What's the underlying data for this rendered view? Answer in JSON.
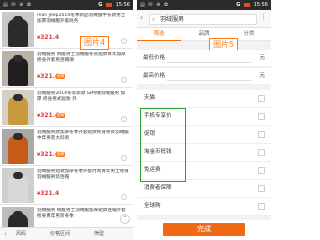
{
  "left": {
    "status": {
      "time": "15:56",
      "signal": "G",
      "icons": "▤ ✉ ⊕ ✿"
    },
    "items": [
      {
        "title": "man Jeep2014冬季新品羽绒服中长款男士加厚羽绒服外套商务",
        "price": "321.4",
        "tag": "",
        "sold": "",
        "bg": "#c9c9c9",
        "coat": "#2b2b2b"
      },
      {
        "title": "羽绒服男 韩版男士羽绒服冬装短款青年加厚修身外套男连帽潮",
        "price": "321.4",
        "tag": "包邮",
        "sold": "",
        "bg": "#b9b3a8",
        "coat": "#1e1e1e"
      },
      {
        "title": "羽绒服男2014冬装新款 白鸭绒羽绒服男 加厚 修身男式短款 外",
        "price": "321.4",
        "tag": "包邮",
        "sold": "",
        "bg": "#d6d0c4",
        "coat": "#c99a3d"
      },
      {
        "title": "羽绒服男款加厚冬季外套短款修身男式羽绒服中年男装大码男",
        "price": "321.4",
        "tag": "包邮",
        "sold": "",
        "bg": "#a9a9a9",
        "coat": "#c65a17"
      },
      {
        "title": "羽绒服男短款加厚冬季外套时尚青年男士修身羽绒服男装连帽",
        "price": "321.4",
        "tag": "",
        "sold": "",
        "bg": "#cfcfcf",
        "coat": "#d8d8d8"
      },
      {
        "title": "羽绒服男 韩版男士羽绒服加厚短款连帽外套修身青年男装冬季",
        "price": "321.4",
        "tag": "包邮",
        "sold": "",
        "bg": "#bdbdbd",
        "coat": "#2a2a2a"
      }
    ],
    "label": "图片4",
    "bottom": {
      "back": "‹",
      "b1": "风码",
      "b2": "价格区间",
      "b3": "筛型"
    },
    "fab": "⌃"
  },
  "right": {
    "search": {
      "value": "羽绒服男",
      "back": "‹",
      "menu": "⋮"
    },
    "tabs": [
      {
        "label": "筛选",
        "active": true
      },
      {
        "label": "品牌",
        "active": false
      },
      {
        "label": "分类",
        "active": false
      }
    ],
    "label": "图片5",
    "price_min": {
      "label": "最低价格",
      "unit": "元"
    },
    "price_max": {
      "label": "最高价格",
      "unit": "元"
    },
    "options": [
      {
        "label": "天猫"
      },
      {
        "label": "手机专享价"
      },
      {
        "label": "促销"
      },
      {
        "label": "淘金币抵钱"
      },
      {
        "label": "免运费"
      },
      {
        "label": "消费者保障"
      },
      {
        "label": "全球购"
      }
    ],
    "done": "完成"
  },
  "colors": {
    "accent": "#ff6a00",
    "price": "#e4393c",
    "highlight_box": "#2e9e3a"
  }
}
